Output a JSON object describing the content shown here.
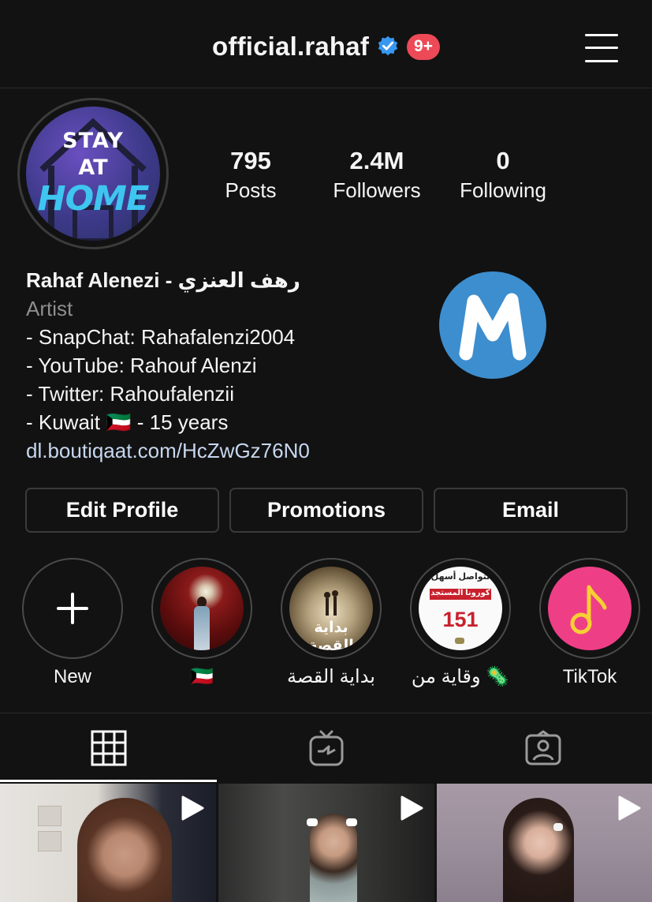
{
  "header": {
    "username": "official.rahaf",
    "notification_badge": "9+",
    "icons": [
      "verified-badge-icon",
      "menu-icon"
    ]
  },
  "profile": {
    "avatar_text": [
      "STAY",
      "AT",
      "HOME"
    ],
    "stats": [
      {
        "value": "795",
        "label": "Posts"
      },
      {
        "value": "2.4M",
        "label": "Followers"
      },
      {
        "value": "0",
        "label": "Following"
      }
    ],
    "bio": {
      "name": "Rahaf Alenezi - رهف العنزي",
      "category": "Artist",
      "lines": [
        "- SnapChat: Rahafalenzi2004",
        "- YouTube: Rahouf Alenzi",
        "- Twitter: Rahoufalenzii",
        "- Kuwait 🇰🇼 - 15 years"
      ],
      "link": "dl.boutiqaat.com/HcZwGz76N0"
    },
    "logo_letter": "M"
  },
  "buttons": {
    "edit_profile": "Edit Profile",
    "promotions": "Promotions",
    "email": "Email"
  },
  "highlights": [
    {
      "label": "New"
    },
    {
      "label": "🇰🇼"
    },
    {
      "label": "بداية القصة",
      "image_text": "بداية القصة"
    },
    {
      "label": "وقاية من 🦠",
      "image_text_top": "لتواصل أسهل",
      "image_text_mid": "كورونا المستجد",
      "image_number": "151"
    },
    {
      "label": "TikTok"
    }
  ],
  "tabs": [
    "grid-icon",
    "igtv-icon",
    "tagged-icon"
  ],
  "colors": {
    "background": "#121212",
    "badge": "#ed4956",
    "verified": "#3897f0",
    "link": "#c7d7ef",
    "muted": "#8e8e8e",
    "logo_blue": "#3d8ecf",
    "tiktok_pink": "#ee3f86"
  }
}
